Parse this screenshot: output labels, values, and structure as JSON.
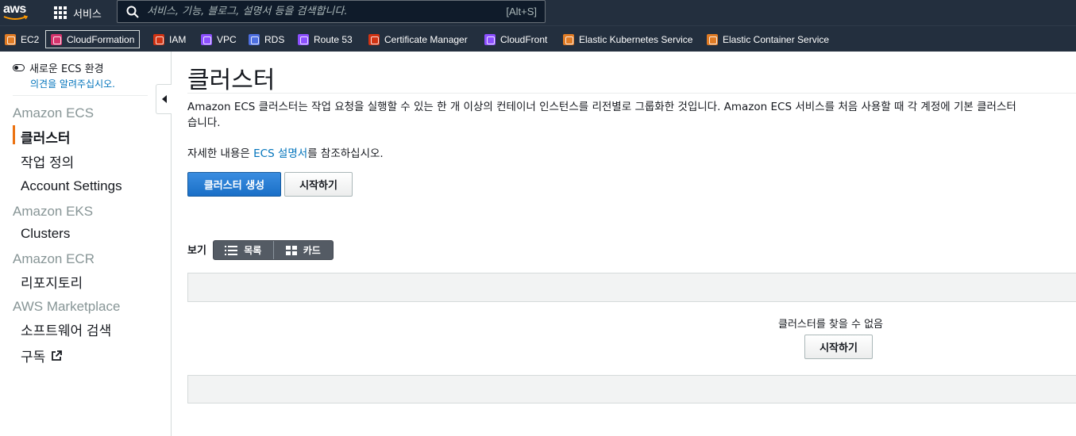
{
  "topnav": {
    "logo_text": "aws",
    "services_label": "서비스",
    "search_placeholder": "서비스, 기능, 블로그, 설명서 등을 검색합니다.",
    "search_shortcut": "[Alt+S]"
  },
  "favorites": [
    {
      "label": "EC2",
      "color": "#e07b24"
    },
    {
      "label": "CloudFormation",
      "color": "#d6336c",
      "selected": true
    },
    {
      "label": "IAM",
      "color": "#d13212"
    },
    {
      "label": "VPC",
      "color": "#8c4fff"
    },
    {
      "label": "RDS",
      "color": "#4d6ee0"
    },
    {
      "label": "Route 53",
      "color": "#8c4fff"
    },
    {
      "label": "Certificate Manager",
      "color": "#d13212"
    },
    {
      "label": "CloudFront",
      "color": "#8c4fff"
    },
    {
      "label": "Elastic Kubernetes Service",
      "color": "#e07b24"
    },
    {
      "label": "Elastic Container Service",
      "color": "#e07b24"
    }
  ],
  "sidebar": {
    "new_ecs_label": "새로운 ECS 환경",
    "feedback_link": "의견을 알려주십시오.",
    "sections": {
      "ecs": "Amazon ECS",
      "eks": "Amazon EKS",
      "ecr": "Amazon ECR",
      "marketplace": "AWS Marketplace"
    },
    "items": {
      "clusters": "클러스터",
      "task_defs": "작업 정의",
      "account_settings": "Account Settings",
      "eks_clusters": "Clusters",
      "repositories": "리포지토리",
      "discover_software": "소프트웨어 검색",
      "subscriptions": "구독"
    }
  },
  "main": {
    "title": "클러스터",
    "description_line1": "Amazon ECS 클러스터는 작업 요청을 실행할 수 있는 한 개 이상의 컨테이너 인스턴스를 리전별로 그룹화한 것입니다. Amazon ECS 서비스를 처음 사용할 때 각 계정에 기본 클러스터",
    "description_line2": "습니다.",
    "more_info_prefix": "자세한 내용은 ",
    "more_info_link": "ECS 설명서",
    "more_info_suffix": "를 참조하십시오.",
    "create_button": "클러스터 생성",
    "get_started_button": "시작하기",
    "view_label": "보기",
    "view_list": "목록",
    "view_card": "카드",
    "empty_message": "클러스터를 찾을 수 없음",
    "empty_get_started": "시작하기"
  }
}
